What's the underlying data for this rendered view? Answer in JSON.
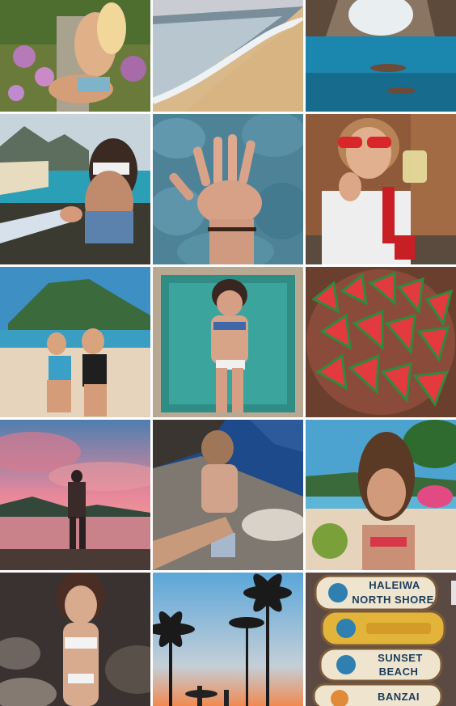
{
  "grid": {
    "columns": 3,
    "rows": 5,
    "tiles": [
      {
        "subject": "woman in floral bikini sitting on garden ledge"
      },
      {
        "subject": "sandy beach shoreline with waves"
      },
      {
        "subject": "swimmers in turquoise cave water"
      },
      {
        "subject": "woman leading by the hand at coastal overlook"
      },
      {
        "subject": "hand with bracelet against blue rocks"
      },
      {
        "subject": "woman in red sunglasses holding a drink"
      },
      {
        "subject": "two women in bikinis on a beach with mountain"
      },
      {
        "subject": "woman sunbathing on a teal towel"
      },
      {
        "subject": "plate of sliced watermelon"
      },
      {
        "subject": "couple on rocks at pink sunset"
      },
      {
        "subject": "woman leading by the hand on rocky shore"
      },
      {
        "subject": "woman with coconut drink on a beach"
      },
      {
        "subject": "woman in white crochet bikini on rocks"
      },
      {
        "subject": "palm tree silhouettes with surfers at sunset"
      },
      {
        "subject": "wooden signpost with surf spot names"
      }
    ]
  },
  "signpost": {
    "sign_1_line_1": "HALEIWA",
    "sign_1_line_2": "NORTH SHORE",
    "sign_3_line_1": "SUNSET",
    "sign_3_line_2": "BEACH",
    "sign_4_line_1": "BANZAI"
  },
  "colors": {
    "ocean": "#1f7fa6",
    "sand": "#d9b98a",
    "sunset_pink": "#e8879a",
    "watermelon": "#e23a3f",
    "rock_blue": "#5a8fa3"
  }
}
